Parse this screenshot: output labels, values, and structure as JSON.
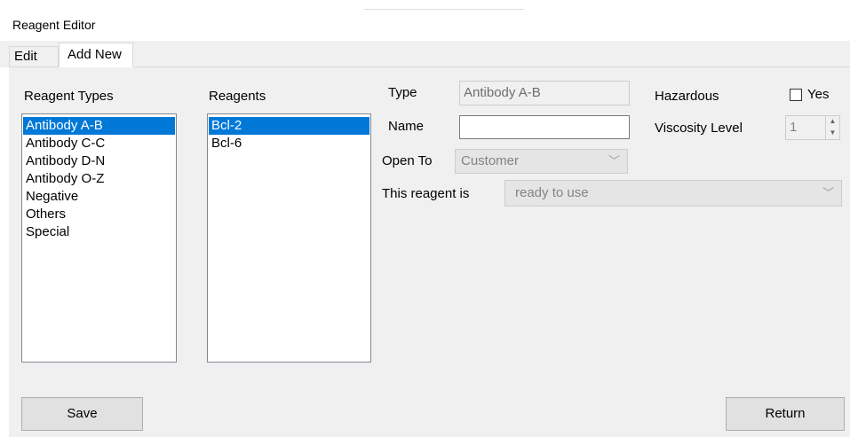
{
  "window": {
    "title": "Reagent Editor"
  },
  "tabs": [
    {
      "label": "Edit"
    },
    {
      "label": "Add New"
    }
  ],
  "reagent_types": {
    "label": "Reagent Types",
    "items": [
      "Antibody A-B",
      "Antibody C-C",
      "Antibody D-N",
      "Antibody O-Z",
      "Negative",
      "Others",
      "Special"
    ],
    "selected": "Antibody A-B"
  },
  "reagents": {
    "label": "Reagents",
    "items": [
      "Bcl-2",
      "Bcl-6"
    ],
    "selected": "Bcl-2"
  },
  "form": {
    "type_label": "Type",
    "type_value": "Antibody A-B",
    "name_label": "Name",
    "name_value": "",
    "open_to_label": "Open To",
    "open_to_value": "Customer",
    "this_reagent_is_label": "This reagent is",
    "this_reagent_is_value": "ready to use",
    "hazardous_label": "Hazardous",
    "hazardous_checkbox_label": "Yes",
    "hazardous_checked": false,
    "viscosity_label": "Viscosity Level",
    "viscosity_value": "1"
  },
  "buttons": {
    "save": "Save",
    "return": "Return"
  },
  "colors": {
    "selection": "#0078d7",
    "panel": "#f0f0f0"
  }
}
